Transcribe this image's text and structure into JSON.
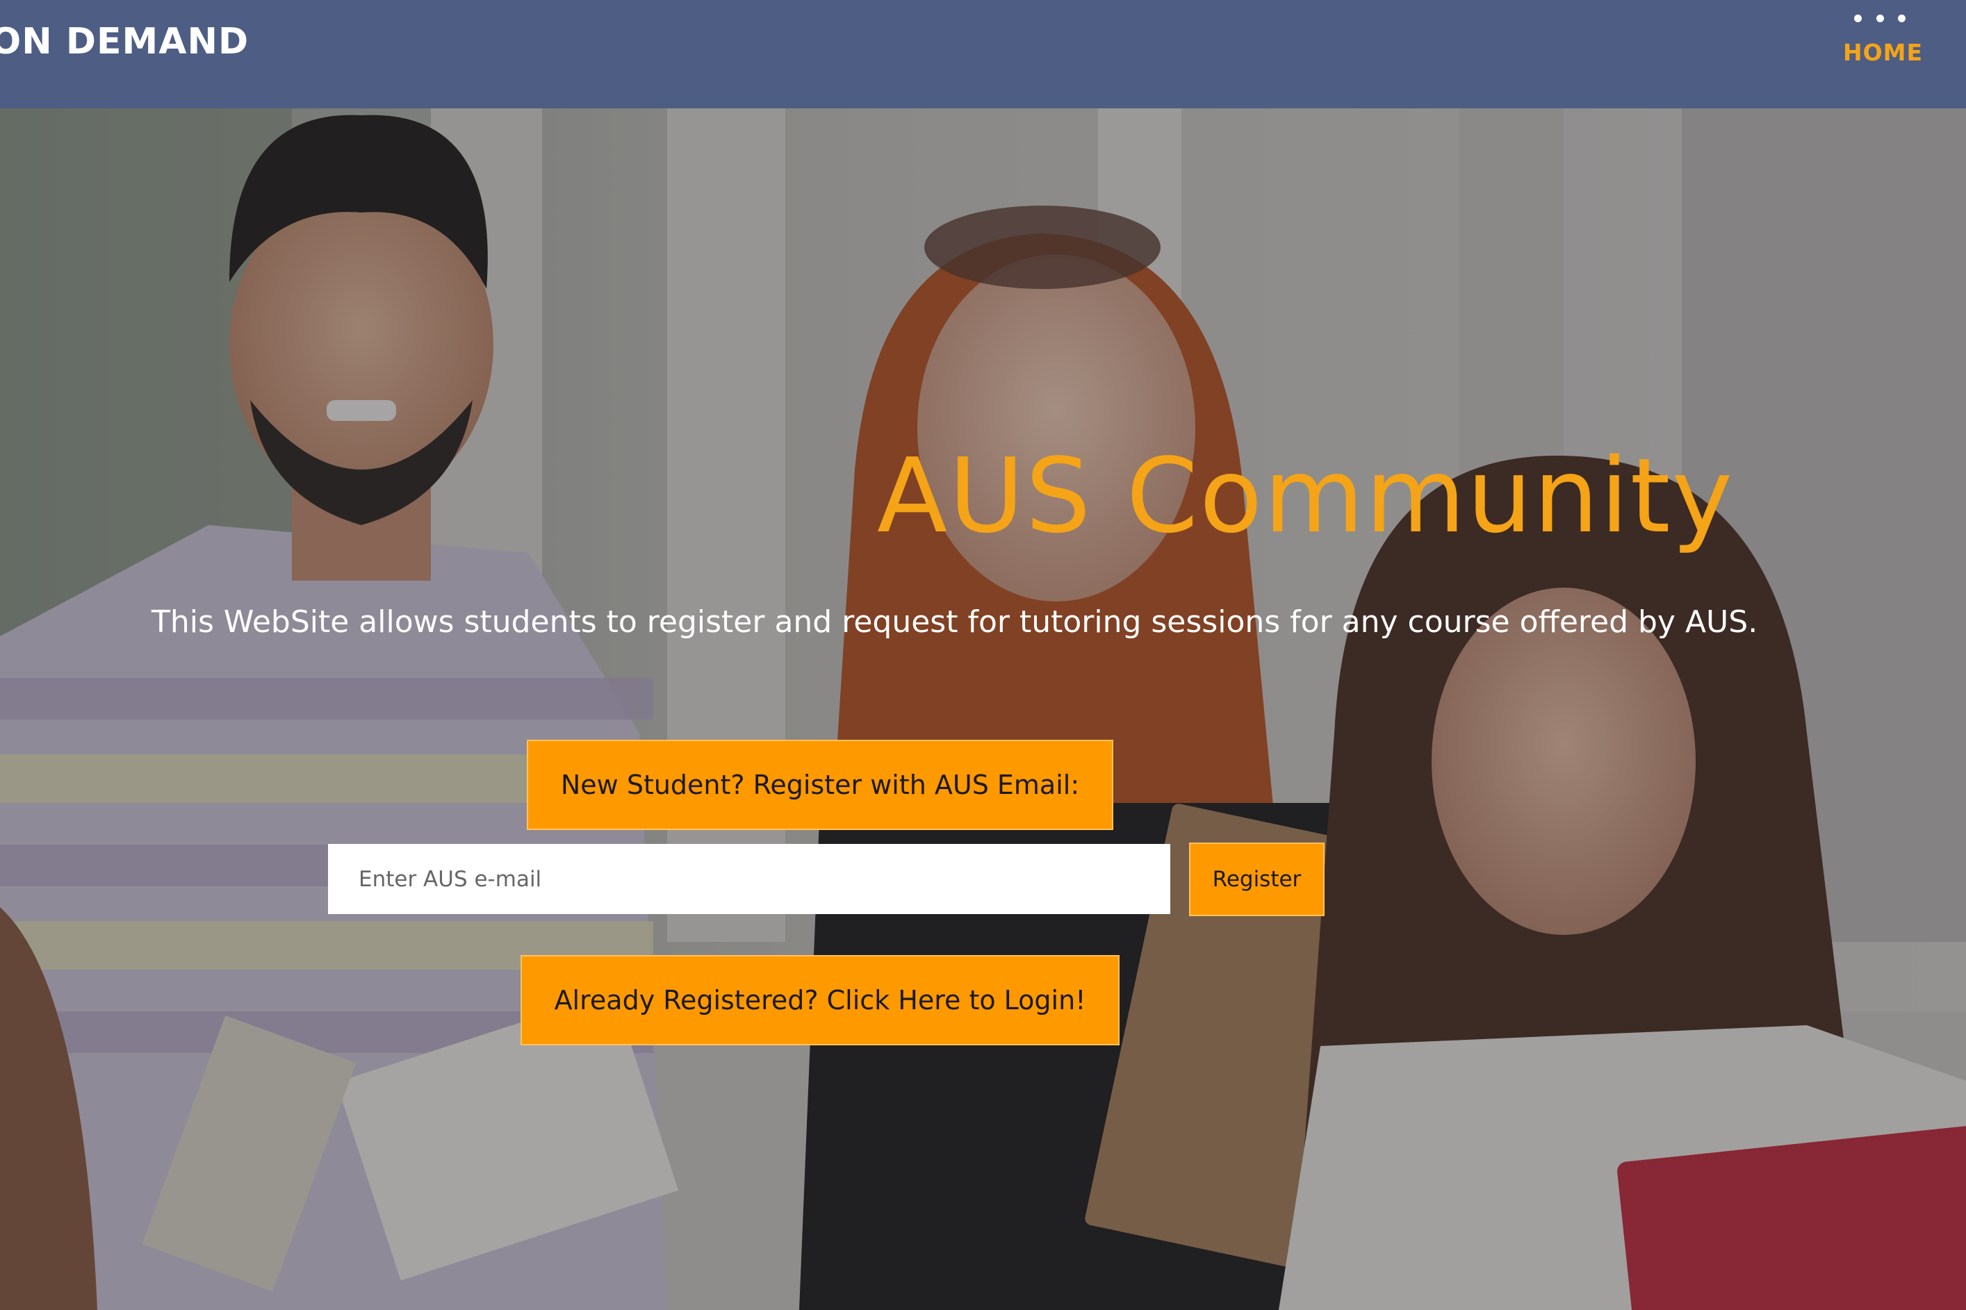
{
  "navbar": {
    "brand": "ON DEMAND",
    "menu_icon": "more-dots-icon",
    "home_label": "HOME"
  },
  "hero": {
    "title": "AUS Community",
    "subtitle": "This WebSite allows students to register and request for tutoring sessions for any course offered by AUS.",
    "register_prompt_label": "New Student? Register with AUS Email:",
    "email_placeholder": "Enter AUS e-mail",
    "email_value": "",
    "register_button_label": "Register",
    "login_button_label": "Already Registered? Click Here to Login!"
  },
  "colors": {
    "navbar_bg": "#4d5d84",
    "accent": "#f5a417",
    "button_bg": "#ff9900"
  }
}
